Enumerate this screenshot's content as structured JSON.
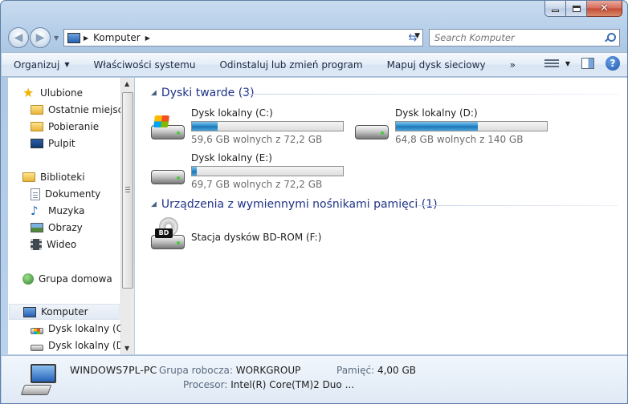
{
  "address": {
    "location": "Komputer"
  },
  "search": {
    "placeholder": "Search Komputer"
  },
  "toolbar": {
    "organize": "Organizuj",
    "system_properties": "Właściwości systemu",
    "uninstall": "Odinstaluj lub zmień program",
    "map_drive": "Mapuj dysk sieciowy",
    "more": "»"
  },
  "sidebar": {
    "favorites": "Ulubione",
    "recent": "Ostatnie miejsca",
    "downloads": "Pobieranie",
    "desktop": "Pulpit",
    "libraries": "Biblioteki",
    "documents": "Dokumenty",
    "music": "Muzyka",
    "pictures": "Obrazy",
    "videos": "Wideo",
    "homegroup": "Grupa domowa",
    "computer": "Komputer",
    "drive_c": "Dysk lokalny (C:)",
    "drive_d": "Dysk lokalny (D:)"
  },
  "groups": {
    "hard_drives": "Dyski twarde (3)",
    "removable": "Urządzenia z wymiennymi nośnikami pamięci (1)"
  },
  "drives": {
    "c": {
      "name": "Dysk lokalny (C:)",
      "free": "59,6 GB wolnych z 72,2 GB",
      "used_fraction": 0.17
    },
    "d": {
      "name": "Dysk lokalny (D:)",
      "free": "64,8 GB wolnych z 140 GB",
      "used_fraction": 0.54
    },
    "e": {
      "name": "Dysk lokalny (E:)",
      "free": "69,7 GB wolnych z 72,2 GB",
      "used_fraction": 0.03
    },
    "bd": {
      "name": "Stacja dysków BD-ROM (F:)",
      "badge": "BD"
    }
  },
  "details": {
    "pc_name": "WINDOWS7PL-PC",
    "workgroup_label": "Grupa robocza:",
    "workgroup_value": "WORKGROUP",
    "memory_label": "Pamięć:",
    "memory_value": "4,00 GB",
    "cpu_label": "Procesor:",
    "cpu_value": "Intel(R) Core(TM)2 Duo ..."
  },
  "colors": {
    "group_header": "#1e3287",
    "bar_fill": "#2687c8"
  }
}
